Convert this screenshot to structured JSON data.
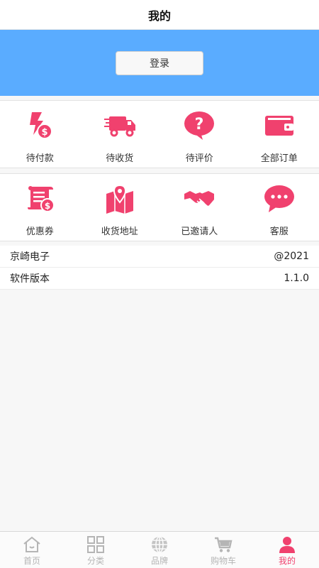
{
  "header": {
    "title": "我的"
  },
  "banner": {
    "background": "#5aacff",
    "login_label": "登录"
  },
  "accent": "#f0416e",
  "orders": [
    {
      "label": "待付款",
      "icon": "pending-payment-icon"
    },
    {
      "label": "待收货",
      "icon": "delivery-truck-icon"
    },
    {
      "label": "待评价",
      "icon": "question-bubble-icon"
    },
    {
      "label": "全部订单",
      "icon": "wallet-icon"
    }
  ],
  "services": [
    {
      "label": "优惠券",
      "icon": "coupon-scroll-icon"
    },
    {
      "label": "收货地址",
      "icon": "map-pin-icon"
    },
    {
      "label": "已邀请人",
      "icon": "handshake-icon"
    },
    {
      "label": "客服",
      "icon": "chat-bubble-icon"
    }
  ],
  "info": [
    {
      "label": "京崎电子",
      "value": "@2021"
    },
    {
      "label": "软件版本",
      "value": "1.1.0"
    }
  ],
  "tabbar": {
    "items": [
      {
        "label": "首页",
        "icon": "home-icon",
        "active": false
      },
      {
        "label": "分类",
        "icon": "grid-icon",
        "active": false
      },
      {
        "label": "品牌",
        "icon": "globe-icon",
        "active": false
      },
      {
        "label": "购物车",
        "icon": "cart-icon",
        "active": false
      },
      {
        "label": "我的",
        "icon": "user-icon",
        "active": true
      }
    ],
    "active_color": "#f0416e",
    "inactive_color": "#b5b5b5"
  }
}
